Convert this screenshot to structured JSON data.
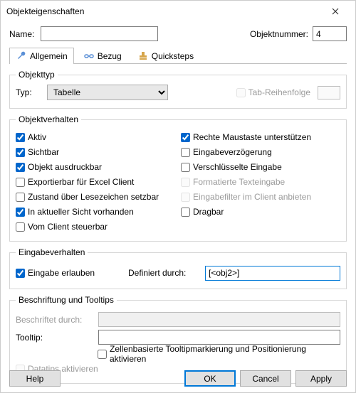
{
  "window": {
    "title": "Objekteigenschaften"
  },
  "name_row": {
    "label": "Name:",
    "value": ""
  },
  "objnum_row": {
    "label": "Objektnummer:",
    "value": "4"
  },
  "tabs": {
    "general": "Allgemein",
    "bezug": "Bezug",
    "quicksteps": "Quicksteps"
  },
  "objekttyp": {
    "legend": "Objekttyp",
    "typ_label": "Typ:",
    "typ_value": "Tabelle",
    "tab_order": "Tab-Reihenfolge",
    "tab_order_value": ""
  },
  "verhalten": {
    "legend": "Objektverhalten",
    "left": {
      "aktiv": "Aktiv",
      "sichtbar": "Sichtbar",
      "ausdruckbar": "Objekt ausdruckbar",
      "exportierbar": "Exportierbar für Excel Client",
      "zustand": "Zustand über Lesezeichen setzbar",
      "inaktueller": "In aktueller Sicht vorhanden",
      "vomclient": "Vom Client steuerbar"
    },
    "right": {
      "rechte": "Rechte Maustaste unterstützen",
      "eingabeverz": "Eingabeverzögerung",
      "verschl": "Verschlüsselte Eingabe",
      "formatierte": "Formatierte Texteingabe",
      "eingabefilter": "Eingabefilter im Client anbieten",
      "dragbar": "Dragbar"
    }
  },
  "eingabe": {
    "legend": "Eingabeverhalten",
    "erlauben": "Eingabe erlauben",
    "definiert_label": "Definiert durch:",
    "definiert_value": "[<obj2>]"
  },
  "beschriftung": {
    "legend": "Beschriftung und Tooltips",
    "beschriftet_label": "Beschriftet durch:",
    "beschriftet_value": "",
    "tooltip_label": "Tooltip:",
    "tooltip_value": "",
    "zellen": "Zellenbasierte Tooltipmarkierung und Positionierung aktivieren",
    "datatips": "Datatips aktivieren"
  },
  "buttons": {
    "help": "Help",
    "ok": "OK",
    "cancel": "Cancel",
    "apply": "Apply"
  }
}
